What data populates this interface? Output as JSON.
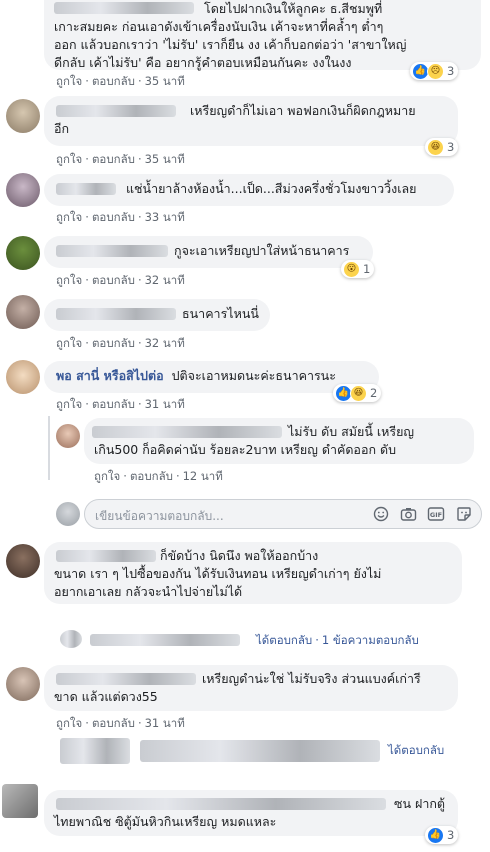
{
  "common": {
    "like_label": "ถูกใจ",
    "reply_label": "ตอบกลับ",
    "dot": "·"
  },
  "comments": [
    {
      "text_lines": [
        "โดยไปฝากเงินให้ลูกคะ ธ.สีชมพูที่",
        "เกาะสมยคะ ก่อนเอาดังเข้าเครื่องนับเงิน เค้าจะหาที่คล้ำๆ ต่ำๆ",
        "ออก แล้วบอกเราว่า 'ไม่รับ' เราก็ยืน งง เค้าก็บอกต่อว่า 'สาขาใหญ่",
        "ดีกลับ เค้าไม่รับ' คือ อยากรู้คำตอบเหมือนกันคะ งงในงง"
      ],
      "time": "35 นาที",
      "reactions": {
        "count": "3",
        "icons": [
          "like-icon",
          "sad-icon"
        ]
      }
    },
    {
      "text_lines": [
        "เหรียญดำก็ไม่เอา พอฟอกเงินก็ผิดกฎหมาย",
        "อีก"
      ],
      "time": "35 นาที",
      "reactions": {
        "count": "3",
        "icons": [
          "haha-icon"
        ]
      }
    },
    {
      "text_lines": [
        "แช่น้ำยาล้างห้องน้ำ...เป็ด...สีม่วงครึ่งชั่วโมงขาววิ้งเลย"
      ],
      "time": "33 นาที"
    },
    {
      "text_lines": [
        "กูจะเอาเหรียญปาใส่หน้าธนาคาร"
      ],
      "time": "32 นาที",
      "reactions": {
        "count": "1",
        "icons": [
          "wow-icon"
        ]
      }
    },
    {
      "text_lines": [
        "ธนาคารไหนนี่"
      ],
      "time": "32 นาที"
    },
    {
      "author": "พอ สานี่ หรือสิไปต่อ",
      "text_lines": [
        "ปติจะเอาหมดนะค่ะธนาคารนะ"
      ],
      "time": "31 นาที",
      "reactions": {
        "count": "2",
        "icons": [
          "like-icon",
          "haha-icon"
        ]
      }
    },
    {
      "text_lines": [
        "ไม่รับ ดับ สมัยนี้ เหรียญ",
        "เกิน500 ก็อคิดค่านับ ร้อยละ2บาท เหรียญ ดำคัดออก ดับ"
      ],
      "time": "12 นาที"
    },
    {
      "text_lines": [
        "ก็ขัดบ้าง นิดนึง พอให้ออกบ้าง",
        "ขนาด เรา ๆ ไปซื้อของกัน ได้รับเงินทอน เหรียญดำเก่าๆ ยังไม่",
        "อยากเอาเลย กลัวจะนำไปจ่ายไม่ได้"
      ],
      "time": ""
    },
    {
      "text_lines": [
        "เหรียญดำน่ะใช่ ไม่รับจริง ส่วนแบงค์เก่ารี",
        "ขาด แล้วแต่ดวง55"
      ],
      "time": "31 นาที"
    },
    {
      "text_lines": [
        "ซน ฝากตู้",
        "ไทยพาณิช ซิตู้มันหิวกินเหรียญ หมดแหละ"
      ],
      "time": "",
      "reactions": {
        "count": "3",
        "icons": [
          "like-icon"
        ]
      }
    }
  ],
  "reply_input": {
    "placeholder": "เขียนข้อความตอบกลับ..."
  },
  "reply_summary": {
    "first": {
      "replied": "ได้ตอบกลับ",
      "count": "1 ข้อความตอบกลับ"
    },
    "second": {
      "replied": "ได้ตอบกลับ"
    }
  }
}
